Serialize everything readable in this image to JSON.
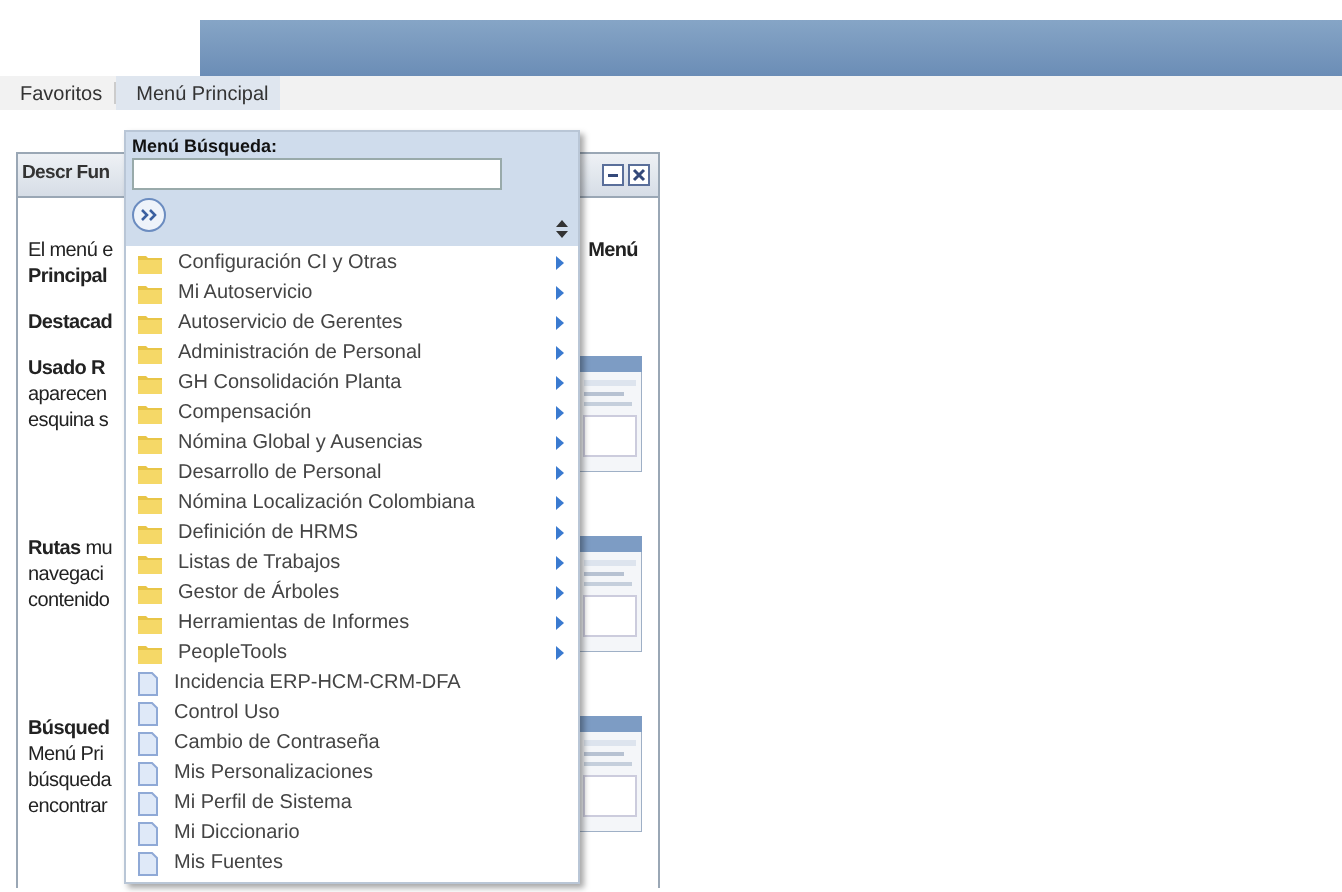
{
  "menubar": [
    {
      "label": "Favoritos",
      "selected": false
    },
    {
      "label": "Menú Principal",
      "selected": true
    }
  ],
  "pagelet": {
    "title": "Descr Fun",
    "blocks": [
      {
        "lines": [
          {
            "left": "El menú e",
            "right": "Menú",
            "bold": false
          },
          {
            "left": "Principal",
            "bold": true
          }
        ]
      },
      {
        "lines": [
          {
            "left": "Destacad",
            "bold": true
          }
        ]
      },
      {
        "lines": [
          {
            "left": "Usado R",
            "bold": true
          },
          {
            "left": "aparecen",
            "bold": false
          },
          {
            "left": "esquina s",
            "bold": false
          }
        ],
        "thumbnail": {
          "kind": "picture"
        }
      },
      {
        "lines": [
          {
            "left": "**Rutas** mu",
            "bold": false
          },
          {
            "left": "navegaci",
            "bold": false
          },
          {
            "left": "contenido",
            "bold": false
          }
        ],
        "thumbnail": {
          "kind": "picture"
        }
      },
      {
        "lines": [
          {
            "left": "Búsqued",
            "bold": true
          },
          {
            "left": "Menú Pri",
            "bold": false
          },
          {
            "left": "búsqueda",
            "bold": false
          },
          {
            "left": "encontrar",
            "bold": false
          }
        ],
        "thumbnail": {
          "kind": "picture"
        }
      }
    ]
  },
  "dropdown": {
    "search_label": "Menú Búsqueda:",
    "items": [
      {
        "label": "Configuración CI y Otras",
        "kind": "folder"
      },
      {
        "label": "Mi Autoservicio",
        "kind": "folder"
      },
      {
        "label": "Autoservicio de Gerentes",
        "kind": "folder"
      },
      {
        "label": "Administración de Personal",
        "kind": "folder"
      },
      {
        "label": "GH Consolidación Planta",
        "kind": "folder"
      },
      {
        "label": "Compensación",
        "kind": "folder"
      },
      {
        "label": "Nómina Global y Ausencias",
        "kind": "folder"
      },
      {
        "label": "Desarrollo de Personal",
        "kind": "folder"
      },
      {
        "label": "Nómina Localización Colombiana",
        "kind": "folder"
      },
      {
        "label": "Definición de HRMS",
        "kind": "folder"
      },
      {
        "label": "Listas de Trabajos",
        "kind": "folder"
      },
      {
        "label": "Gestor de Árboles",
        "kind": "folder"
      },
      {
        "label": "Herramientas de Informes",
        "kind": "folder"
      },
      {
        "label": "PeopleTools",
        "kind": "folder"
      },
      {
        "label": "Incidencia ERP-HCM-CRM-DFA",
        "kind": "page"
      },
      {
        "label": "Control Uso",
        "kind": "page"
      },
      {
        "label": "Cambio de Contraseña",
        "kind": "page"
      },
      {
        "label": "Mis Personalizaciones",
        "kind": "page"
      },
      {
        "label": "Mi Perfil de Sistema",
        "kind": "page"
      },
      {
        "label": "Mi Diccionario",
        "kind": "page"
      },
      {
        "label": "Mis Fuentes",
        "kind": "page"
      }
    ]
  }
}
